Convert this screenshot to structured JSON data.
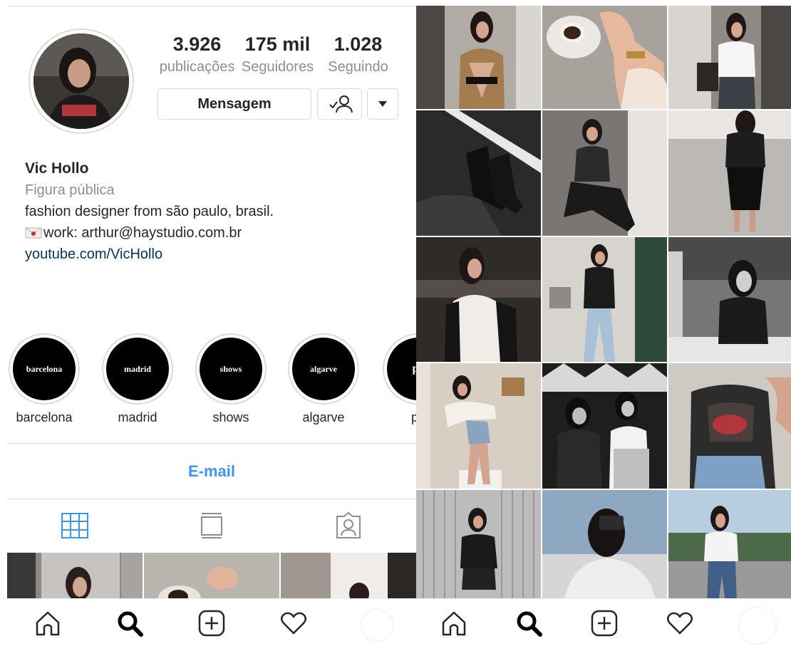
{
  "profile": {
    "stats": [
      {
        "value": "3.926",
        "label": "publicações"
      },
      {
        "value": "175 mil",
        "label": "Seguidores"
      },
      {
        "value": "1.028",
        "label": "Seguindo"
      }
    ],
    "message_label": "Mensagem",
    "name": "Vic Hollo",
    "category": "Figura pública",
    "bio_line": "fashion designer from são paulo, brasil.",
    "work_line": "work: arthur@haystudio.com.br",
    "link": "youtube.com/VicHollo",
    "highlights": [
      {
        "cover": "barcelona",
        "label": "barcelona"
      },
      {
        "cover": "madrid",
        "label": "madrid"
      },
      {
        "cover": "shows",
        "label": "shows"
      },
      {
        "cover": "algarve",
        "label": "algarve"
      },
      {
        "cover": "po",
        "label": "po"
      }
    ],
    "email_label": "E-mail"
  },
  "tabs": [
    {
      "icon": "grid-icon",
      "active": true
    },
    {
      "icon": "igtv-icon",
      "active": false
    },
    {
      "icon": "tagged-icon",
      "active": false
    }
  ],
  "bottom_nav": [
    "home-icon",
    "search-icon",
    "add-post-icon",
    "heart-icon",
    "profile-avatar"
  ],
  "colors": {
    "link_blue": "#3897f0",
    "bio_link": "#003569",
    "border": "#dbdbdb",
    "muted": "#8e8e8e",
    "text": "#262626"
  }
}
